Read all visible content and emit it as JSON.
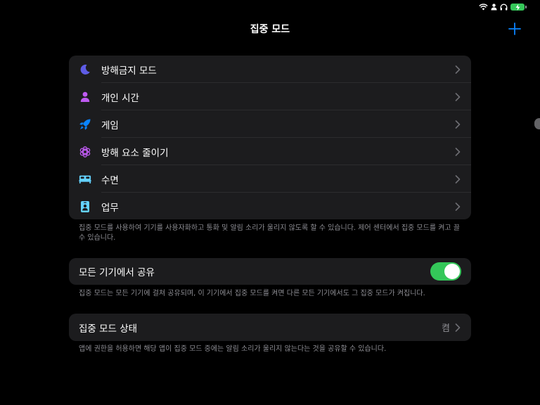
{
  "nav": {
    "title": "집중 모드"
  },
  "focus_modes": [
    {
      "label": "방해금지 모드",
      "icon": "moon-icon",
      "color": "#5e5ce6"
    },
    {
      "label": "개인 시간",
      "icon": "person-icon",
      "color": "#bf5af2"
    },
    {
      "label": "게임",
      "icon": "rocket-icon",
      "color": "#0a84ff"
    },
    {
      "label": "방해 요소 줄이기",
      "icon": "reduce-interruptions-icon",
      "color": "#bf5af2"
    },
    {
      "label": "수면",
      "icon": "bed-icon",
      "color": "#64d2ff"
    },
    {
      "label": "업무",
      "icon": "work-badge-icon",
      "color": "#64d2ff"
    }
  ],
  "modes_footer": "집중 모드를 사용하여 기기를 사용자화하고 통화 및 알림 소리가 울리지 않도록 할 수 있습니다. 제어 센터에서 집중 모드를 켜고 끌 수 있습니다.",
  "share": {
    "label": "모든 기기에서 공유",
    "enabled": true,
    "footer": "집중 모드는 모든 기기에 걸쳐 공유되며, 이 기기에서 집중 모드를 켜면 다른 모든 기기에서도 그 집중 모드가 켜집니다."
  },
  "focus_status": {
    "label": "집중 모드 상태",
    "value": "켬",
    "footer": "앱에 권한을 허용하면 해당 앱이 집중 모드 중에는 알림 소리가 울리지 않는다는 것을 공유할 수 있습니다."
  },
  "colors": {
    "accent": "#0a84ff",
    "toggle_on": "#34c759",
    "battery": "#35c759"
  }
}
